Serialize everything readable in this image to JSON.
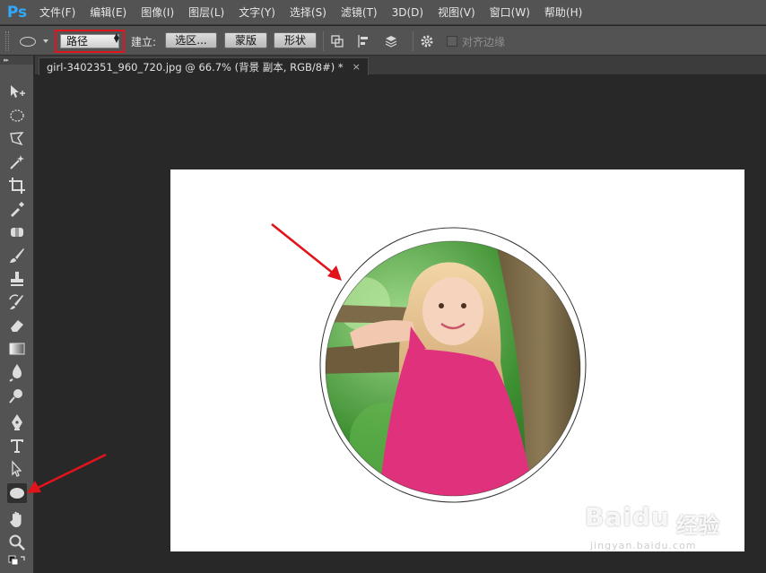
{
  "app": {
    "logo": "Ps",
    "menu": [
      "文件(F)",
      "编辑(E)",
      "图像(I)",
      "图层(L)",
      "文字(Y)",
      "选择(S)",
      "滤镜(T)",
      "3D(D)",
      "视图(V)",
      "窗口(W)",
      "帮助(H)"
    ]
  },
  "options": {
    "mode_value": "路径",
    "build_label": "建立:",
    "selection_button": "选区...",
    "mask_button": "蒙版",
    "shape_button": "形状",
    "align_edges_label": "对齐边缘"
  },
  "document": {
    "tab_title": "girl-3402351_960_720.jpg @ 66.7% (背景 副本, RGB/8#) *",
    "close_glyph": "×"
  },
  "watermark": {
    "logo": "Baidu",
    "cn": "经验",
    "url": "jingyan.baidu.com"
  },
  "colors": {
    "accent": "#31a8ff",
    "highlight_red": "#e0141a"
  }
}
